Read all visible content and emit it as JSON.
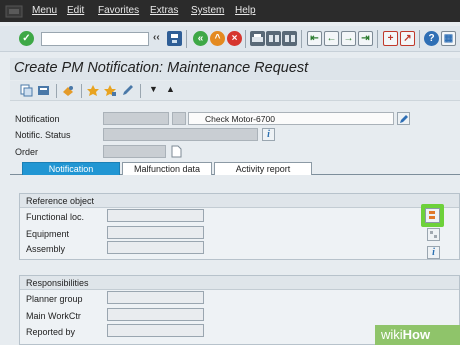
{
  "menubar": {
    "items": [
      "Menu",
      "Edit",
      "Favorites",
      "Extras",
      "System",
      "Help"
    ]
  },
  "toolbar": {
    "command_field_value": "",
    "chevron": "‹‹",
    "icons": [
      "enter-icon",
      "save-icon",
      "back-icon",
      "exit-icon",
      "cancel-icon",
      "print-icon",
      "find-icon",
      "find-next-icon",
      "first-page-icon",
      "previous-page-icon",
      "next-page-icon",
      "last-page-icon",
      "new-session-icon",
      "shortcut-icon",
      "help-icon",
      "customize-layout-icon"
    ]
  },
  "title": "Create PM Notification: Maintenance Request",
  "header": {
    "notification_label": "Notification",
    "notification_value": "Check Motor-6700",
    "status_label": "Notific. Status",
    "order_label": "Order"
  },
  "tabs": [
    {
      "label": "Notification",
      "active": true
    },
    {
      "label": "Malfunction data",
      "active": false
    },
    {
      "label": "Activity report",
      "active": false
    }
  ],
  "reference_object": {
    "title": "Reference object",
    "fields": [
      {
        "label": "Functional loc.",
        "value": ""
      },
      {
        "label": "Equipment",
        "value": ""
      },
      {
        "label": "Assembly",
        "value": ""
      }
    ]
  },
  "responsibilities": {
    "title": "Responsibilities",
    "fields": [
      {
        "label": "Planner group",
        "value": ""
      },
      {
        "label": "Main WorkCtr",
        "value": ""
      },
      {
        "label": "Reported by",
        "value": ""
      }
    ]
  },
  "watermark": {
    "wiki": "wiki",
    "how": "How"
  },
  "colors": {
    "menubar_bg": "#2b2b2b",
    "active_tab": "#2196d3",
    "highlight": "#6dd13a",
    "watermark_bg": "#8fc46a"
  }
}
